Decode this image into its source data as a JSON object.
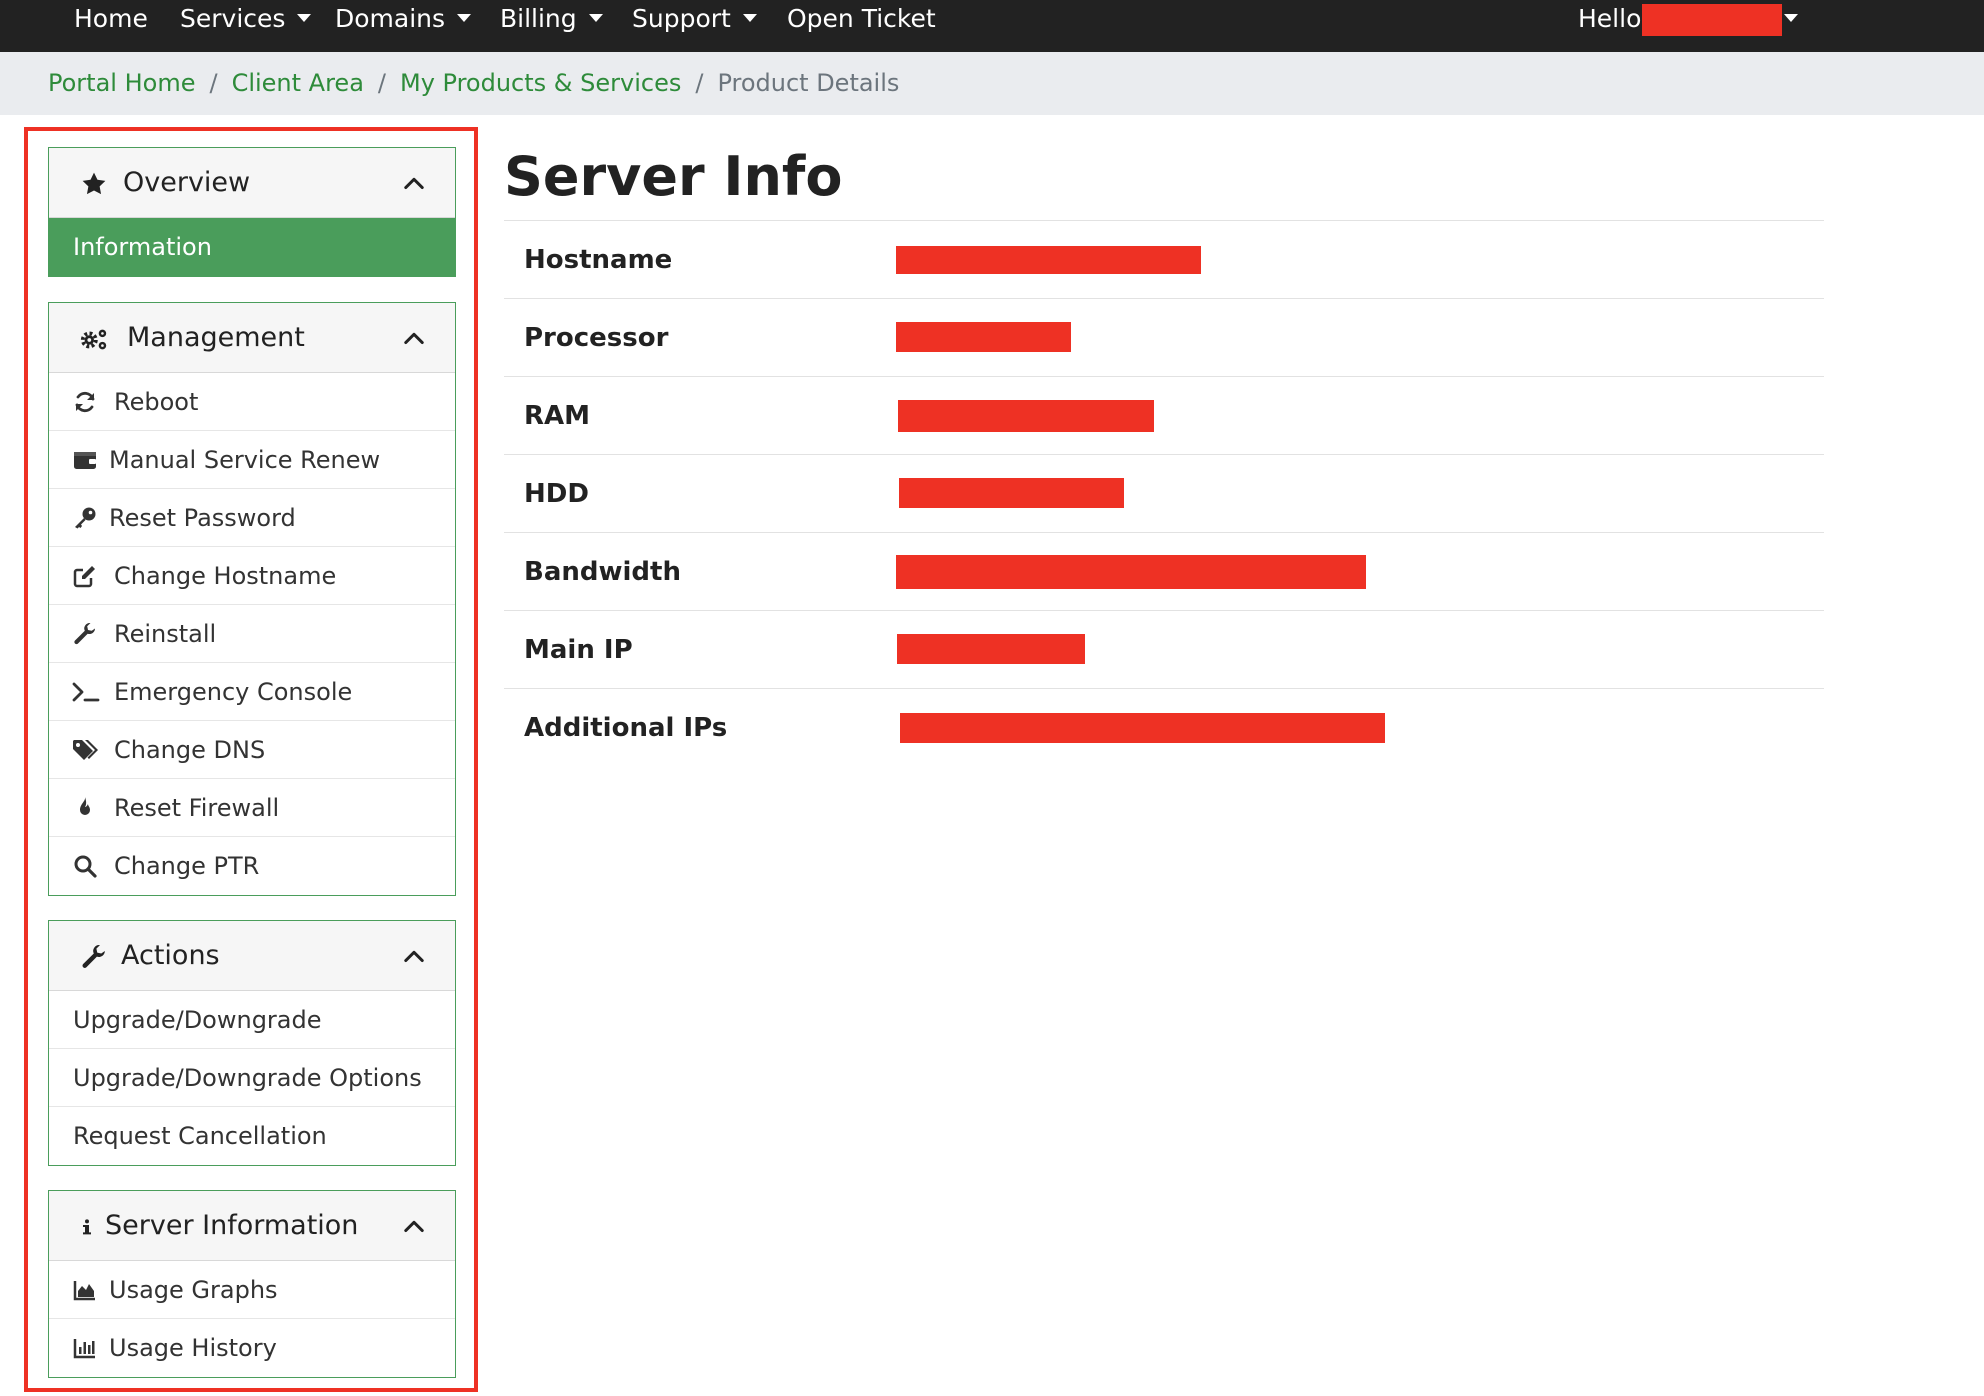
{
  "topnav": {
    "items": [
      {
        "label": "Home",
        "dropdown": false
      },
      {
        "label": "Services",
        "dropdown": true
      },
      {
        "label": "Domains",
        "dropdown": true
      },
      {
        "label": "Billing",
        "dropdown": true
      },
      {
        "label": "Support",
        "dropdown": true
      },
      {
        "label": "Open Ticket",
        "dropdown": false
      }
    ],
    "hello": "Hello,"
  },
  "breadcrumb": {
    "items": [
      "Portal Home",
      "Client Area",
      "My Products & Services"
    ],
    "separator": "/",
    "current": "Product Details"
  },
  "sidebar": {
    "overview": {
      "title": "Overview",
      "icon": "star-icon",
      "items": [
        {
          "label": "Information",
          "active": true
        }
      ]
    },
    "management": {
      "title": "Management",
      "icon": "gears-icon",
      "items": [
        {
          "label": "Reboot",
          "icon": "refresh-icon"
        },
        {
          "label": "Manual Service Renew",
          "icon": "wallet-icon"
        },
        {
          "label": "Reset Password",
          "icon": "key-icon"
        },
        {
          "label": "Change Hostname",
          "icon": "edit-icon"
        },
        {
          "label": "Reinstall",
          "icon": "wrench-icon"
        },
        {
          "label": "Emergency Console",
          "icon": "terminal-icon"
        },
        {
          "label": "Change DNS",
          "icon": "tags-icon"
        },
        {
          "label": "Reset Firewall",
          "icon": "fire-icon"
        },
        {
          "label": "Change PTR",
          "icon": "search-icon"
        }
      ]
    },
    "actions": {
      "title": "Actions",
      "icon": "wrench-icon",
      "items": [
        {
          "label": "Upgrade/Downgrade"
        },
        {
          "label": "Upgrade/Downgrade Options"
        },
        {
          "label": "Request Cancellation"
        }
      ]
    },
    "server_information": {
      "title": "Server Information",
      "icon": "info-icon",
      "items": [
        {
          "label": "Usage Graphs",
          "icon": "area-chart-icon"
        },
        {
          "label": "Usage History",
          "icon": "bar-chart-icon"
        }
      ]
    }
  },
  "main": {
    "title": "Server Info",
    "rows": [
      {
        "label": "Hostname"
      },
      {
        "label": "Processor"
      },
      {
        "label": "RAM"
      },
      {
        "label": "HDD"
      },
      {
        "label": "Bandwidth"
      },
      {
        "label": "Main IP"
      },
      {
        "label": "Additional IPs"
      }
    ]
  },
  "colors": {
    "nav_bg": "#222222",
    "accent_green": "#4a9d5b",
    "link_green": "#2e8b3a",
    "redaction_red": "#ee3124",
    "breadcrumb_bg": "#eaecef"
  }
}
